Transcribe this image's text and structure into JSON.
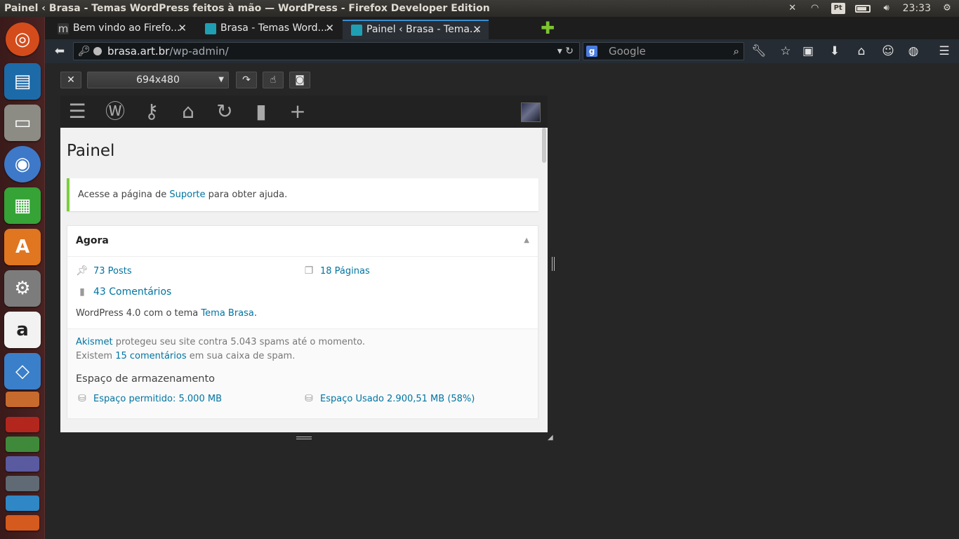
{
  "topbar": {
    "window_title": "Painel ‹ Brasa - Temas WordPress feitos à mão — WordPress - Firefox Developer Edition",
    "keyboard_layout": "Pt",
    "clock": "23:33"
  },
  "launcher": {
    "icons": [
      "ubuntu-dash",
      "libreoffice-writer",
      "file-manager",
      "chromium",
      "libreoffice-calc",
      "ubuntu-software-center",
      "system-settings",
      "amazon",
      "dropbox",
      "libreoffice-impress",
      "filezilla",
      "dvd",
      "php",
      "more-apps"
    ]
  },
  "tabs": [
    {
      "label": "Bem vindo ao Firefo...",
      "active": false
    },
    {
      "label": "Brasa - Temas Word...",
      "active": false
    },
    {
      "label": "Painel ‹ Brasa - Tema...",
      "active": true
    }
  ],
  "navbar": {
    "url_host": "brasa.art.br",
    "url_path": "/wp-admin/",
    "search_placeholder": "Google"
  },
  "responsive": {
    "size": "694x480"
  },
  "wp": {
    "page_title": "Painel",
    "notice": {
      "prefix": "Acesse a página de ",
      "link": "Suporte",
      "suffix": " para obter ajuda."
    },
    "agora": {
      "title": "Agora",
      "posts": "73 Posts",
      "pages": "18 Páginas",
      "comments": "43 Comentários",
      "version_prefix": "WordPress 4.0 com o tema ",
      "theme_link": "Tema Brasa",
      "version_suffix": ".",
      "akismet_link": "Akismet",
      "akismet_text": " protegeu seu site contra 5.043 spams até o momento.",
      "spam_prefix": "Existem ",
      "spam_link": "15 comentários",
      "spam_suffix": " em sua caixa de spam.",
      "storage_title": "Espaço de armazenamento",
      "storage_allowed": "Espaço permitido: 5.000 MB",
      "storage_used": "Espaço Usado 2.900,51 MB (58%)"
    }
  }
}
